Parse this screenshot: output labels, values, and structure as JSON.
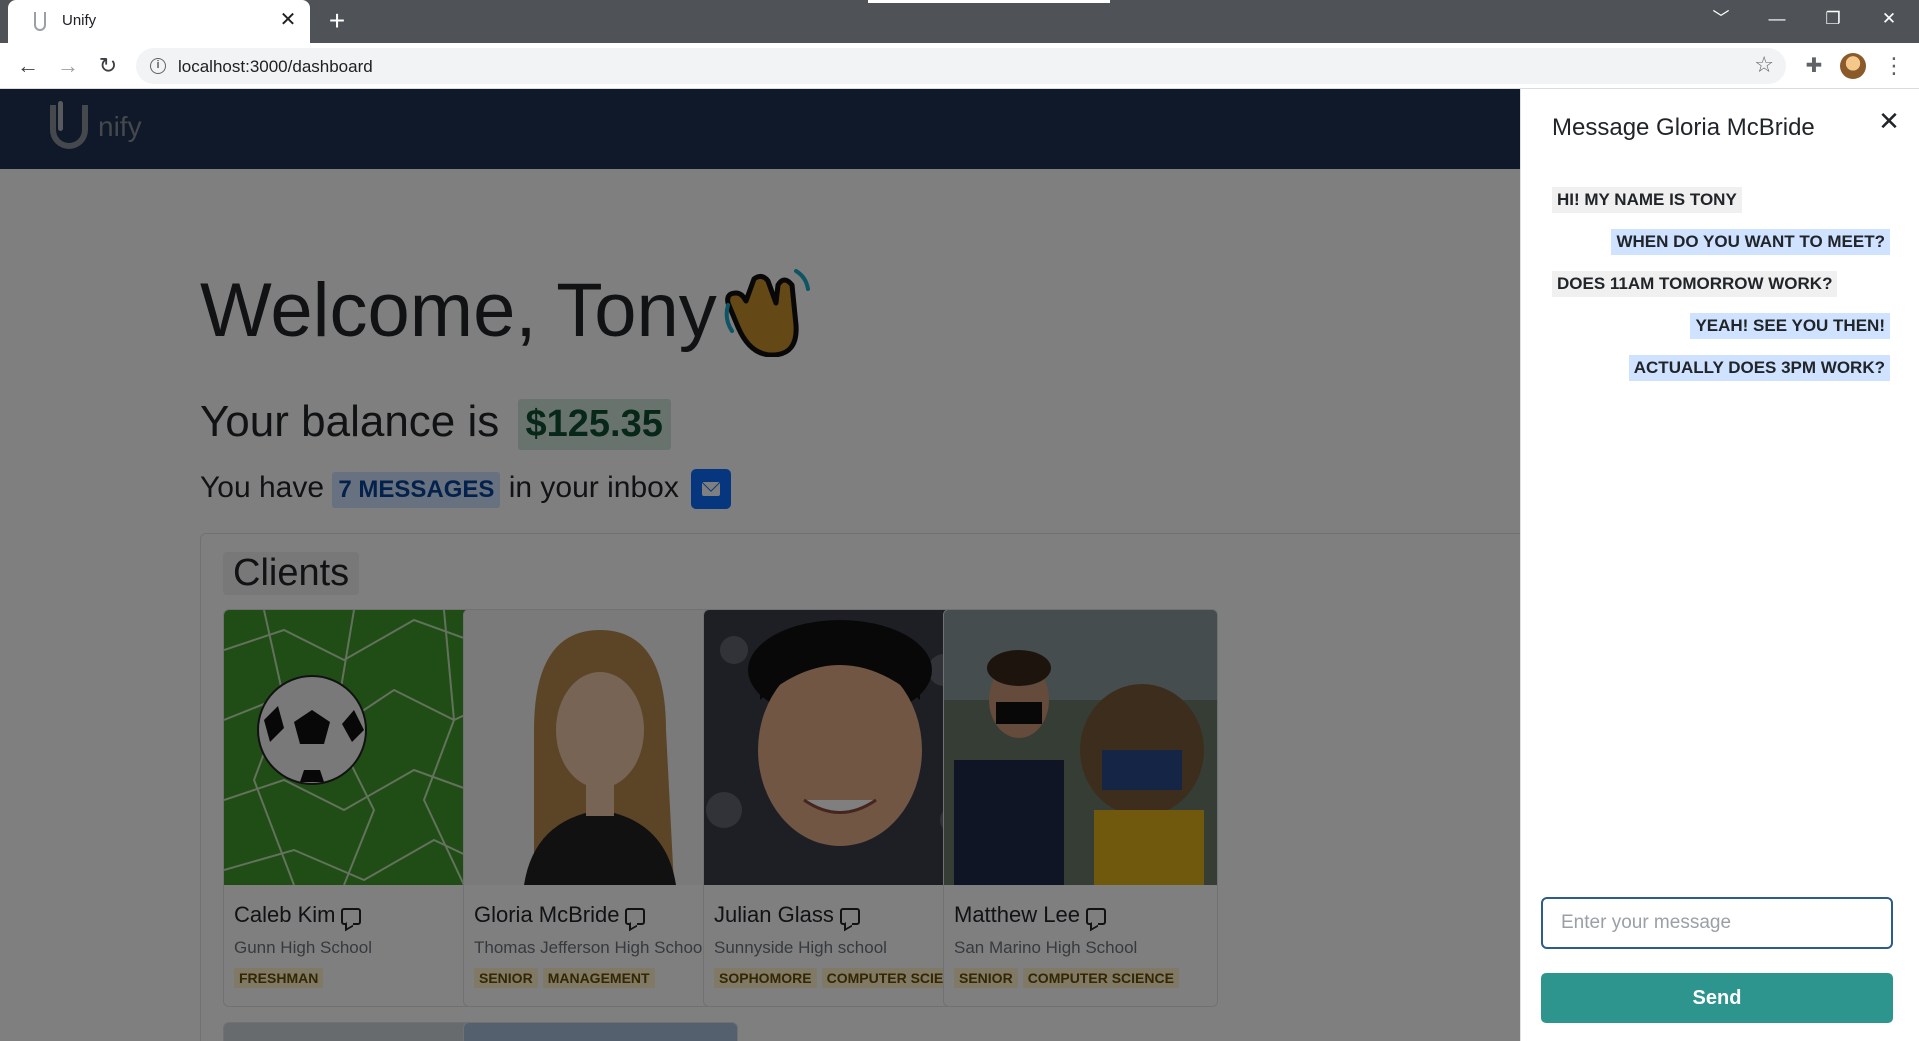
{
  "browser": {
    "tab_title": "Unify",
    "url": "localhost:3000/dashboard",
    "tab_close_glyph": "✕",
    "new_tab_glyph": "+",
    "window_controls": [
      "﹀",
      "—",
      "❐",
      "✕"
    ]
  },
  "app": {
    "logo_text": "nify",
    "welcome_text": "Welcome, Tony",
    "balance_prefix": "Your balance is",
    "balance_value": "$125.35",
    "inbox_prefix": "You have",
    "inbox_count": "7 MESSAGES",
    "inbox_suffix": "in your inbox",
    "clients_title": "Clients",
    "clients": [
      {
        "name": "Caleb Kim",
        "school": "Gunn High School",
        "tags": [
          "FRESHMAN"
        ],
        "photo": "soccer-ball-photo"
      },
      {
        "name": "Gloria McBride",
        "school": "Thomas Jefferson High School",
        "tags": [
          "SENIOR",
          "MANAGEMENT"
        ],
        "photo": "portrait-photo"
      },
      {
        "name": "Julian Glass",
        "school": "Sunnyside High school",
        "tags": [
          "SOPHOMORE",
          "COMPUTER SCIENCE"
        ],
        "photo": "portrait-photo"
      },
      {
        "name": "Matthew Lee",
        "school": "San Marino High School",
        "tags": [
          "SENIOR",
          "COMPUTER SCIENCE"
        ],
        "photo": "mascot-photo"
      }
    ]
  },
  "drawer": {
    "title": "Message Gloria McBride",
    "messages": [
      {
        "text": "HI! MY NAME IS TONY",
        "direction": "in"
      },
      {
        "text": "WHEN DO YOU WANT TO MEET?",
        "direction": "out"
      },
      {
        "text": "DOES 11AM TOMORROW WORK?",
        "direction": "in"
      },
      {
        "text": "YEAH! SEE YOU THEN!",
        "direction": "out"
      },
      {
        "text": "ACTUALLY DOES 3PM WORK?",
        "direction": "out"
      }
    ],
    "input_placeholder": "Enter your message",
    "send_label": "Send"
  },
  "colors": {
    "nav_bg": "#1e3352",
    "balance_badge_bg": "#d1e7dd",
    "message_badge_bg": "#cfe2ff",
    "tag_bg": "#fff3cd",
    "send_button": "#2e948e"
  }
}
